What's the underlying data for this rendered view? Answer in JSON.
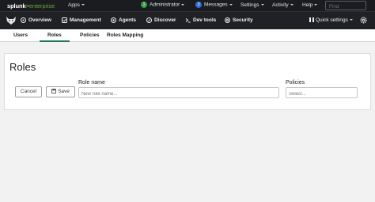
{
  "topbar": {
    "logo_text": "splunk",
    "logo_gt": ">",
    "logo_product": "enterprise",
    "apps": "Apps",
    "admin_badge": "1",
    "admin": "Administrator",
    "messages_badge": "3",
    "messages": "Messages",
    "settings": "Settings",
    "activity": "Activity",
    "help": "Help",
    "find_placeholder": "Find"
  },
  "appbar": {
    "items": [
      "Overview",
      "Management",
      "Agents",
      "Discover",
      "Dev tools",
      "Security"
    ],
    "quick_settings": "Quick settings"
  },
  "tabs": [
    "Users",
    "Roles",
    "Policies",
    "Roles Mapping"
  ],
  "active_tab": "Roles",
  "form": {
    "title": "Roles",
    "cancel_label": "Cancel",
    "save_label": "Save",
    "role_name_label": "Role name",
    "role_name_placeholder": "New role name...",
    "policies_label": "Policies",
    "policies_placeholder": "Select..."
  },
  "colors": {
    "topbar_bg": "#1a1c20",
    "appbar_bg": "#202125",
    "brand_green": "#65a637",
    "admin_badge": "#3c9a44",
    "messages_badge": "#2f6fd6",
    "tab_underline": "#1f7a5a"
  }
}
